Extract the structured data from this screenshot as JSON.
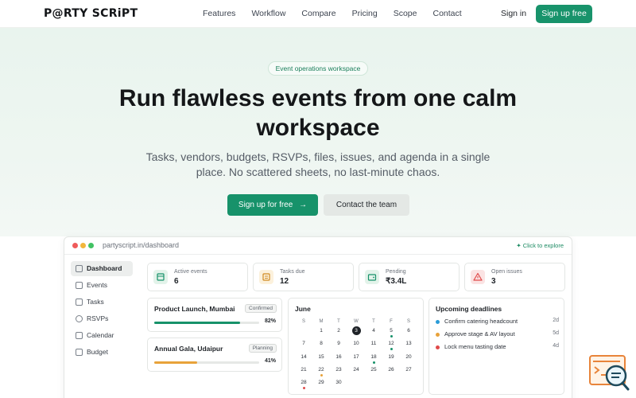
{
  "nav": {
    "logo": "P@RTY SCRiPT",
    "links": [
      "Features",
      "Workflow",
      "Compare",
      "Pricing",
      "Scope",
      "Contact"
    ],
    "signin": "Sign in",
    "signup": "Sign up free"
  },
  "hero": {
    "pill": "Event operations workspace",
    "headline": "Run flawless events from one calm workspace",
    "subheadline": "Tasks, vendors, budgets, RSVPs, files, issues, and agenda in a single place. No scattered sheets, no last-minute chaos.",
    "cta_primary": "Sign up for free",
    "cta_secondary": "Contact the team"
  },
  "app": {
    "url": "partyscript.in/dashboard",
    "explore": "Click to explore",
    "sidebar": [
      {
        "label": "Dashboard",
        "icon": "grid-icon",
        "active": true
      },
      {
        "label": "Events",
        "icon": "calendar-icon",
        "active": false
      },
      {
        "label": "Tasks",
        "icon": "checkbox-icon",
        "active": false
      },
      {
        "label": "RSVPs",
        "icon": "user-icon",
        "active": false
      },
      {
        "label": "Calendar",
        "icon": "calendar-icon",
        "active": false
      },
      {
        "label": "Budget",
        "icon": "wallet-icon",
        "active": false
      }
    ],
    "stats": [
      {
        "label": "Active events",
        "value": "6",
        "icon": "calendar-icon"
      },
      {
        "label": "Tasks due",
        "value": "12",
        "icon": "clipboard-icon"
      },
      {
        "label": "Pending",
        "value": "₹3.4L",
        "icon": "wallet-icon"
      },
      {
        "label": "Open issues",
        "value": "3",
        "icon": "warning-icon"
      }
    ],
    "projects": [
      {
        "name": "Product Launch, Mumbai",
        "status": "Confirmed",
        "progress": 82,
        "progress_label": "82%",
        "color": "#17926a"
      },
      {
        "name": "Annual Gala, Udaipur",
        "status": "Planning",
        "progress": 41,
        "progress_label": "41%",
        "color": "#e8a23a"
      }
    ],
    "calendar": {
      "month": "June",
      "weekdays": [
        "S",
        "M",
        "T",
        "W",
        "T",
        "F",
        "S"
      ],
      "days": [
        "",
        "1",
        "2",
        "3",
        "4",
        "5",
        "6",
        "7",
        "8",
        "9",
        "10",
        "11",
        "12",
        "13",
        "14",
        "15",
        "16",
        "17",
        "18",
        "19",
        "20",
        "21",
        "22",
        "23",
        "24",
        "25",
        "26",
        "27",
        "28",
        "29",
        "30"
      ],
      "today": "3",
      "marks": {
        "5": "#17926a",
        "12": "#17926a",
        "18": "#17926a",
        "22": "#e8a23a",
        "28": "#e04a4a"
      }
    },
    "deadlines": {
      "title": "Upcoming deadlines",
      "items": [
        {
          "text": "Confirm catering headcount",
          "when": "2d",
          "color": "#2a9bd8"
        },
        {
          "text": "Approve stage & AV layout",
          "when": "5d",
          "color": "#e8a23a"
        },
        {
          "text": "Lock menu tasting date",
          "when": "4d",
          "color": "#e04a4a"
        }
      ]
    }
  },
  "colors": {
    "brand": "#17926a",
    "accent_orange": "#e8a23a",
    "danger": "#e04a4a"
  }
}
